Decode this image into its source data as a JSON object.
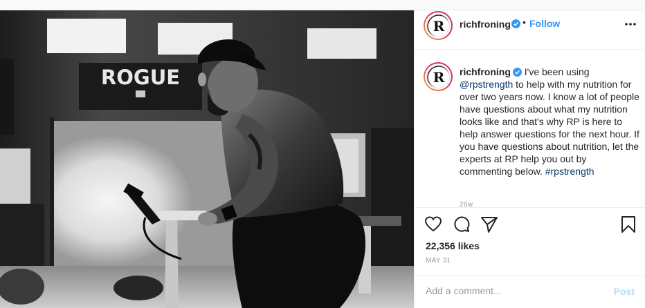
{
  "post": {
    "author": {
      "username": "richfroning",
      "verified": true,
      "follow_label": "Follow",
      "separator": "•",
      "avatar_icon": "rich-froning-r-logo-icon"
    },
    "photo": {
      "sign_text": "ROGUE"
    },
    "caption": {
      "username": "richfroning",
      "text_before_mention": "I've been using",
      "mention": "@rpstrength",
      "text_after_mention": "to help with my nutrition for over two years now. I know a lot of people have questions about what my nutrition looks like and that's why RP is here to help answer questions for the next hour. If you have questions about nutrition, let the experts at RP help you out by commenting below.",
      "hashtag": "#rpstrength",
      "time_ago": "26w"
    },
    "actions": {
      "icons": [
        "heart-icon",
        "comment-icon",
        "share-icon",
        "bookmark-icon"
      ]
    },
    "likes": "22,356 likes",
    "date": "MAY 31",
    "comment_box": {
      "placeholder": "Add a comment...",
      "post_label": "Post"
    },
    "colors": {
      "link": "#3897f0",
      "verified": "#3897f0",
      "post_disabled": "#b2dffc"
    }
  }
}
